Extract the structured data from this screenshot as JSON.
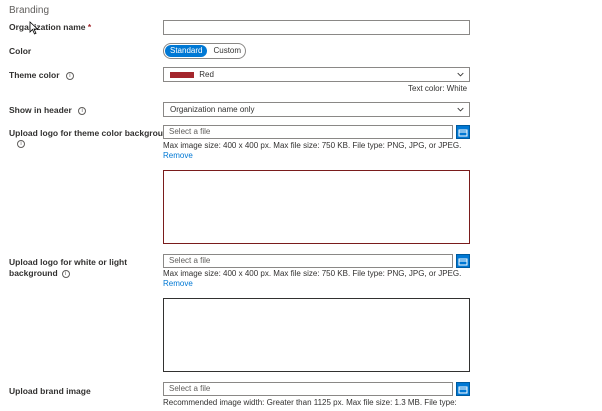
{
  "section": {
    "title": "Branding"
  },
  "org_name": {
    "label": "Organization name",
    "required_mark": "*",
    "value": ""
  },
  "color": {
    "label": "Color",
    "options": [
      "Standard",
      "Custom"
    ],
    "selected": "Standard"
  },
  "theme_color": {
    "label": "Theme color",
    "value": "Red",
    "swatch": "#a4262c",
    "text_color_note": "Text color: White"
  },
  "show_in_header": {
    "label": "Show in header",
    "value": "Organization name only"
  },
  "logo_theme": {
    "label": "Upload logo for theme color background",
    "placeholder": "Select a file",
    "help": "Max image size: 400 x 400 px. Max file size: 750 KB. File type: PNG, JPG, or JPEG.",
    "remove": "Remove",
    "preview_border": "#7a1c1c"
  },
  "logo_light": {
    "label_line1": "Upload logo for white or light",
    "label_line2": "background",
    "placeholder": "Select a file",
    "help": "Max image size: 400 x 400 px. Max file size: 750 KB. File type: PNG, JPG, or JPEG.",
    "remove": "Remove",
    "preview_border": "#323130"
  },
  "brand_image": {
    "label": "Upload brand image",
    "placeholder": "Select a file",
    "help": "Recommended image width: Greater than 1125 px. Max file size: 1.3 MB. File type:"
  },
  "colors": {
    "accent": "#0078d4"
  }
}
